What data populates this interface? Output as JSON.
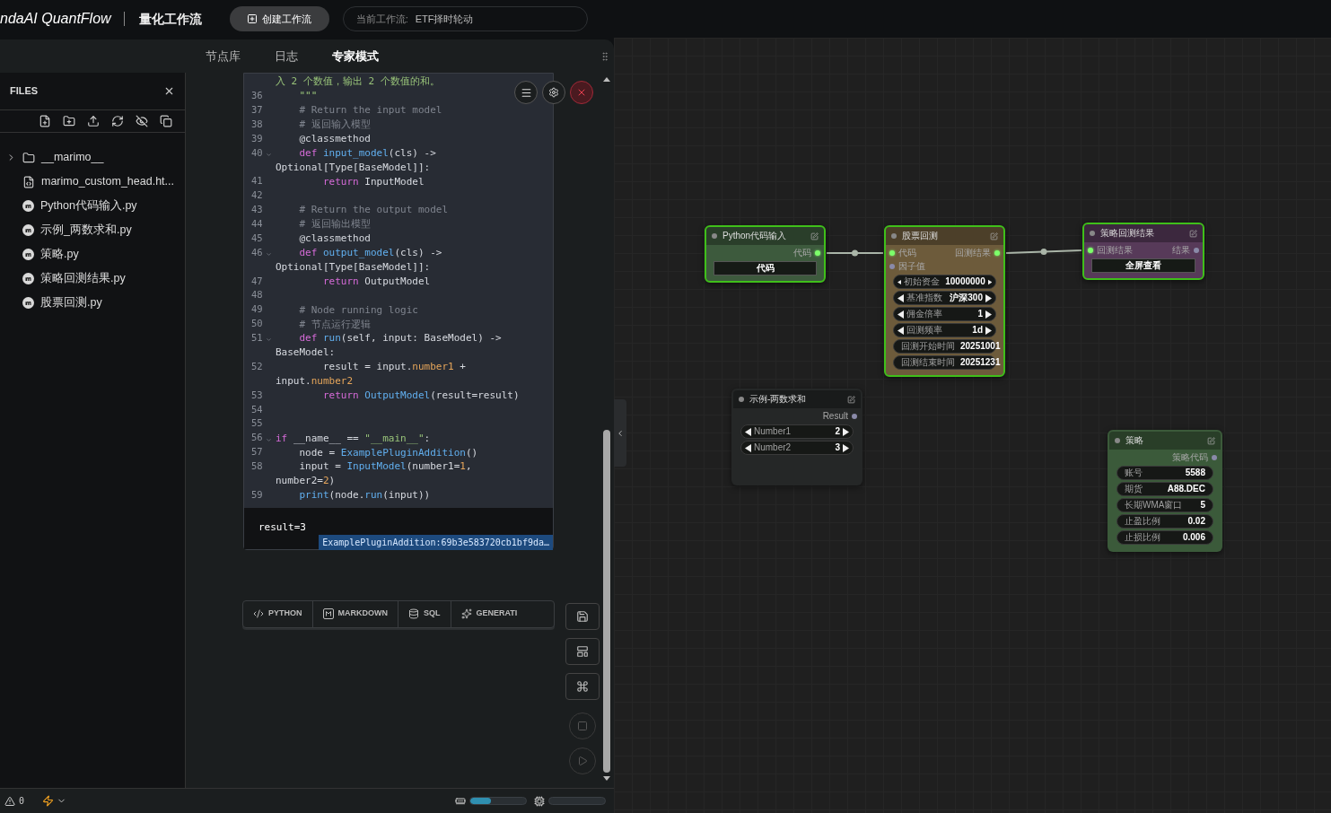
{
  "app": {
    "logo": "ndaAI QuantFlow",
    "section": "量化工作流",
    "create_button": "创建工作流",
    "current_workflow": {
      "label": "当前工作流:",
      "value": "ETF择时轮动"
    }
  },
  "tabs": [
    {
      "label": "节点库",
      "selected": false
    },
    {
      "label": "日志",
      "selected": false
    },
    {
      "label": "专家模式",
      "selected": true
    }
  ],
  "files": {
    "title": "FILES",
    "items": [
      {
        "name": "__marimo__",
        "kind": "folder",
        "expanded": false
      },
      {
        "name": "marimo_custom_head.ht...",
        "kind": "html"
      },
      {
        "name": "Python代码输入.py",
        "kind": "marimo"
      },
      {
        "name": "示例_两数求和.py",
        "kind": "marimo"
      },
      {
        "name": "策略.py",
        "kind": "marimo"
      },
      {
        "name": "策略回测结果.py",
        "kind": "marimo"
      },
      {
        "name": "股票回测.py",
        "kind": "marimo"
      }
    ]
  },
  "code_cell": {
    "lines": [
      {
        "parts": [
          {
            "kind": "str",
            "text": "入 2 个数值，输出 2 个数值的和。"
          }
        ]
      },
      {
        "num": "36",
        "fold": false,
        "parts": [
          {
            "kind": "str",
            "text": "    \"\"\""
          }
        ]
      },
      {
        "num": "37",
        "fold": false,
        "parts": [
          {
            "kind": "cm",
            "text": "    # Return the input model"
          }
        ]
      },
      {
        "num": "38",
        "fold": false,
        "parts": [
          {
            "kind": "cm",
            "text": "    # 返回输入模型"
          }
        ]
      },
      {
        "num": "39",
        "fold": false,
        "parts": [
          {
            "kind": "tx",
            "text": "    @classmethod"
          }
        ]
      },
      {
        "num": "40",
        "fold": true,
        "parts": [
          {
            "kind": "kw",
            "text": "    def "
          },
          {
            "kind": "fn",
            "text": "input_model"
          },
          {
            "kind": "tx",
            "text": "(cls) ->"
          }
        ]
      },
      {
        "parts": [
          {
            "kind": "tx",
            "text": "Optional[Type[BaseModel]]:"
          }
        ]
      },
      {
        "num": "41",
        "fold": false,
        "parts": [
          {
            "kind": "kw",
            "text": "        return "
          },
          {
            "kind": "tx",
            "text": "InputModel"
          }
        ]
      },
      {
        "num": "42",
        "fold": false
      },
      {
        "num": "43",
        "fold": false,
        "parts": [
          {
            "kind": "cm",
            "text": "    # Return the output model"
          }
        ]
      },
      {
        "num": "44",
        "fold": false,
        "parts": [
          {
            "kind": "cm",
            "text": "    # 返回输出模型"
          }
        ]
      },
      {
        "num": "45",
        "fold": false,
        "parts": [
          {
            "kind": "tx",
            "text": "    @classmethod"
          }
        ]
      },
      {
        "num": "46",
        "fold": true,
        "parts": [
          {
            "kind": "kw",
            "text": "    def "
          },
          {
            "kind": "fn",
            "text": "output_model"
          },
          {
            "kind": "tx",
            "text": "(cls) ->"
          }
        ]
      },
      {
        "parts": [
          {
            "kind": "tx",
            "text": "Optional[Type[BaseModel]]:"
          }
        ]
      },
      {
        "num": "47",
        "fold": false,
        "parts": [
          {
            "kind": "kw",
            "text": "        return "
          },
          {
            "kind": "tx",
            "text": "OutputModel"
          }
        ]
      },
      {
        "num": "48",
        "fold": false
      },
      {
        "num": "49",
        "fold": false,
        "parts": [
          {
            "kind": "cm",
            "text": "    # Node running logic"
          }
        ]
      },
      {
        "num": "50",
        "fold": false,
        "parts": [
          {
            "kind": "cm",
            "text": "    # 节点运行逻辑"
          }
        ]
      },
      {
        "num": "51",
        "fold": true,
        "parts": [
          {
            "kind": "kw",
            "text": "    def "
          },
          {
            "kind": "fn",
            "text": "run"
          },
          {
            "kind": "tx",
            "text": "(self, input: BaseModel) ->"
          }
        ]
      },
      {
        "parts": [
          {
            "kind": "tx",
            "text": "BaseModel:"
          }
        ]
      },
      {
        "num": "52",
        "fold": false,
        "parts": [
          {
            "kind": "tx",
            "text": "        result = input."
          },
          {
            "kind": "at",
            "text": "number1"
          },
          {
            "kind": "tx",
            "text": " +"
          }
        ]
      },
      {
        "parts": [
          {
            "kind": "tx",
            "text": "input."
          },
          {
            "kind": "at",
            "text": "number2"
          }
        ]
      },
      {
        "num": "53",
        "fold": false,
        "parts": [
          {
            "kind": "kw",
            "text": "        return "
          },
          {
            "kind": "fn",
            "text": "OutputModel"
          },
          {
            "kind": "tx",
            "text": "(result=result)"
          }
        ]
      },
      {
        "num": "54",
        "fold": false
      },
      {
        "num": "55",
        "fold": false
      },
      {
        "num": "56",
        "fold": true,
        "parts": [
          {
            "kind": "kw",
            "text": "if "
          },
          {
            "kind": "tx",
            "text": "__name__ == "
          },
          {
            "kind": "str",
            "text": "\"__main__\""
          },
          {
            "kind": "tx",
            "text": ":"
          }
        ]
      },
      {
        "num": "57",
        "fold": false,
        "parts": [
          {
            "kind": "tx",
            "text": "    node = "
          },
          {
            "kind": "fn",
            "text": "ExamplePluginAddition"
          },
          {
            "kind": "tx",
            "text": "()"
          }
        ]
      },
      {
        "num": "58",
        "fold": false,
        "parts": [
          {
            "kind": "tx",
            "text": "    input = "
          },
          {
            "kind": "fn",
            "text": "InputModel"
          },
          {
            "kind": "tx",
            "text": "(number1="
          },
          {
            "kind": "num",
            "text": "1"
          },
          {
            "kind": "tx",
            "text": ","
          }
        ]
      },
      {
        "parts": [
          {
            "kind": "tx",
            "text": "number2="
          },
          {
            "kind": "num",
            "text": "2"
          },
          {
            "kind": "tx",
            "text": ")"
          }
        ]
      },
      {
        "num": "59",
        "fold": false,
        "parts": [
          {
            "kind": "fn",
            "text": "    print"
          },
          {
            "kind": "tx",
            "text": "(node."
          },
          {
            "kind": "fn",
            "text": "run"
          },
          {
            "kind": "tx",
            "text": "(input))"
          }
        ]
      }
    ],
    "output": "result=3",
    "cell_id": "ExamplePluginAddition:69b3e583720cb1bf9da…"
  },
  "add_cell": [
    {
      "label": "PYTHON",
      "kind": "python"
    },
    {
      "label": "MARKDOWN",
      "kind": "markdown"
    },
    {
      "label": "SQL",
      "kind": "sql"
    },
    {
      "label": "GENERATI",
      "kind": "ai"
    }
  ],
  "status_bar": {
    "warnings": "0",
    "memory": {
      "level": 0.37
    },
    "cpu": {
      "level": 0
    }
  },
  "canvas": {
    "nodes": [
      {
        "title": "Python代码输入",
        "color": "#3d5a3d",
        "selected": true,
        "outputs": [
          {
            "label": "代码",
            "connected": true
          }
        ],
        "widgets": [
          {
            "kind": "button",
            "label": "代码"
          }
        ]
      },
      {
        "title": "股票回测",
        "color": "#6d5b3b",
        "selected": true,
        "inputs": [
          {
            "label": "代码",
            "connected": true
          },
          {
            "label": "因子值",
            "connected": false
          }
        ],
        "outputs": [
          {
            "label": "回测结果",
            "connected": true
          }
        ],
        "widgets": [
          {
            "kind": "number",
            "label": "初始资金",
            "value": "10000000"
          },
          {
            "kind": "number",
            "label": "基准指数",
            "value": "沪深300"
          },
          {
            "kind": "number",
            "label": "佣金倍率",
            "value": "1"
          },
          {
            "kind": "number",
            "label": "回测频率",
            "value": "1d"
          },
          {
            "kind": "text",
            "label": "回测开始时间",
            "value": "20251001"
          },
          {
            "kind": "text",
            "label": "回测结束时间",
            "value": "20251231"
          }
        ]
      },
      {
        "title": "策略回测结果",
        "color": "#573a59",
        "selected": true,
        "inputs": [
          {
            "label": "回测结果",
            "connected": true
          }
        ],
        "outputs": [
          {
            "label": "结果",
            "connected": false
          }
        ],
        "widgets": [
          {
            "kind": "button",
            "label": "全屏查看"
          }
        ]
      },
      {
        "title": "示例-两数求和",
        "color": "#252727",
        "selected": false,
        "outputs": [
          {
            "label": "Result",
            "connected": false
          }
        ],
        "widgets": [
          {
            "kind": "number",
            "label": "Number1",
            "value": "2"
          },
          {
            "kind": "number",
            "label": "Number2",
            "value": "3"
          }
        ]
      },
      {
        "title": "策略",
        "color": "#3b5a3a",
        "selected": false,
        "outputs": [
          {
            "label": "策略代码",
            "connected": false
          }
        ],
        "widgets": [
          {
            "kind": "text",
            "label": "账号",
            "value": "5588"
          },
          {
            "kind": "text",
            "label": "期货",
            "value": "A88.DEC"
          },
          {
            "kind": "text",
            "label": "长期WMA窗口",
            "value": "5"
          },
          {
            "kind": "text",
            "label": "止盈比例",
            "value": "0.02"
          },
          {
            "kind": "text",
            "label": "止损比例",
            "value": "0.006"
          }
        ]
      }
    ]
  }
}
